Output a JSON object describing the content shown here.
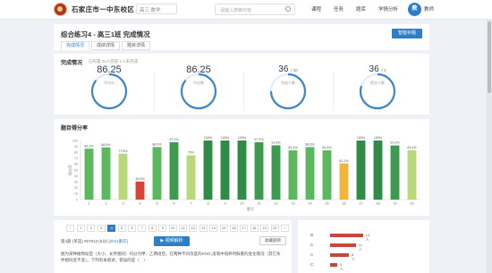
{
  "topnav": {
    "school": "石家庄市一中东校区",
    "subject": "高三 数学",
    "search_placeholder": "请输入搜索内容",
    "items": [
      "课程",
      "任务",
      "题库",
      "学情分析"
    ],
    "avatar": "教",
    "username": "教师"
  },
  "header": {
    "title": "综合练习4 - 高三1班 完成情况",
    "smart_button": "智能补题",
    "tabs": [
      "完成情况",
      "成绩详情",
      "题目详情"
    ]
  },
  "overview": {
    "title": "完成情况",
    "subtitle": "已布置 22人完成 1人未完成",
    "stats": [
      {
        "value": "86.25",
        "caption": "平均分",
        "fraction": 0.86
      },
      {
        "value": "86.25",
        "caption": "中位数",
        "fraction": 0.86
      },
      {
        "value": "36",
        "unit": "/ 10",
        "caption": "完成人数",
        "fraction": 0.75
      },
      {
        "value": "36",
        "unit": "/ 1",
        "caption": "提交人数",
        "fraction": 0.8
      }
    ]
  },
  "chart_data": {
    "type": "bar",
    "title": "题目得分率",
    "xlabel": "题号",
    "ylabel": "得分率",
    "ylim": [
      0,
      100
    ],
    "yticks": [
      0,
      10,
      20,
      30,
      40,
      50,
      60,
      70,
      80,
      90,
      100
    ],
    "categories": [
      "1",
      "2",
      "3",
      "4",
      "5",
      "6",
      "7",
      "8",
      "9",
      "10",
      "11",
      "12",
      "13",
      "14",
      "15",
      "16",
      "17",
      "18",
      "19",
      "20"
    ],
    "values": [
      86.2,
      88.5,
      77.8,
      30.6,
      88.9,
      97.2,
      75,
      100,
      100,
      100,
      97.2,
      91.8,
      83.4,
      88.9,
      83.4,
      61.2,
      100,
      100,
      91.6,
      83.4
    ],
    "value_labels": [
      "86.2%",
      "88.5%",
      "77.8%",
      "30.6%",
      "88.9%",
      "97.2%",
      "75%",
      "100%",
      "100%",
      "100%",
      "97.2%",
      "91.8%",
      "83.4%",
      "88.9%",
      "83.4%",
      "61.2%",
      "100%",
      "100%",
      "91.6%",
      "83.4%"
    ],
    "colors": [
      "#5bb85f",
      "#5bb85f",
      "#b7d97a",
      "#d6433a",
      "#5bb85f",
      "#3e9a4e",
      "#b7d97a",
      "#2f8b45",
      "#2f8b45",
      "#2f8b45",
      "#3e9a4e",
      "#3e9a4e",
      "#5bb85f",
      "#5bb85f",
      "#5bb85f",
      "#f0b63c",
      "#2f8b45",
      "#2f8b45",
      "#3e9a4e",
      "#b7d97a"
    ],
    "grid": false
  },
  "question": {
    "pages": [
      "1",
      "2",
      "3",
      "4",
      "5",
      "6",
      "7",
      "8",
      "9",
      "10",
      "11",
      "12",
      "13",
      "14",
      "15",
      "16",
      "17",
      "18",
      "19",
      "20"
    ],
    "active_page": "4",
    "info_prefix": "第4题 (单选) #67013 (5分)",
    "info_year": "[2011重庆]",
    "video_button": "▶ 视频解析",
    "collect_button": "收藏题目",
    "text": "图为某种植物幼苗（大小、长势相同）均分为甲、乙两组后，在两种不同浓度的KNO₃溶液中培养时鲜重的变化情况（其它条件相同且不变）。下列有关叙述，错误的是（　）"
  },
  "answers": [
    {
      "label": "D",
      "count": "14人",
      "fraction": 0.61
    },
    {
      "label": "C",
      "count": "11人",
      "fraction": 0.48
    },
    {
      "label": "A",
      "count": "8人",
      "fraction": 0.35
    },
    {
      "label": "C",
      "count": "3人",
      "fraction": 0.13
    }
  ]
}
